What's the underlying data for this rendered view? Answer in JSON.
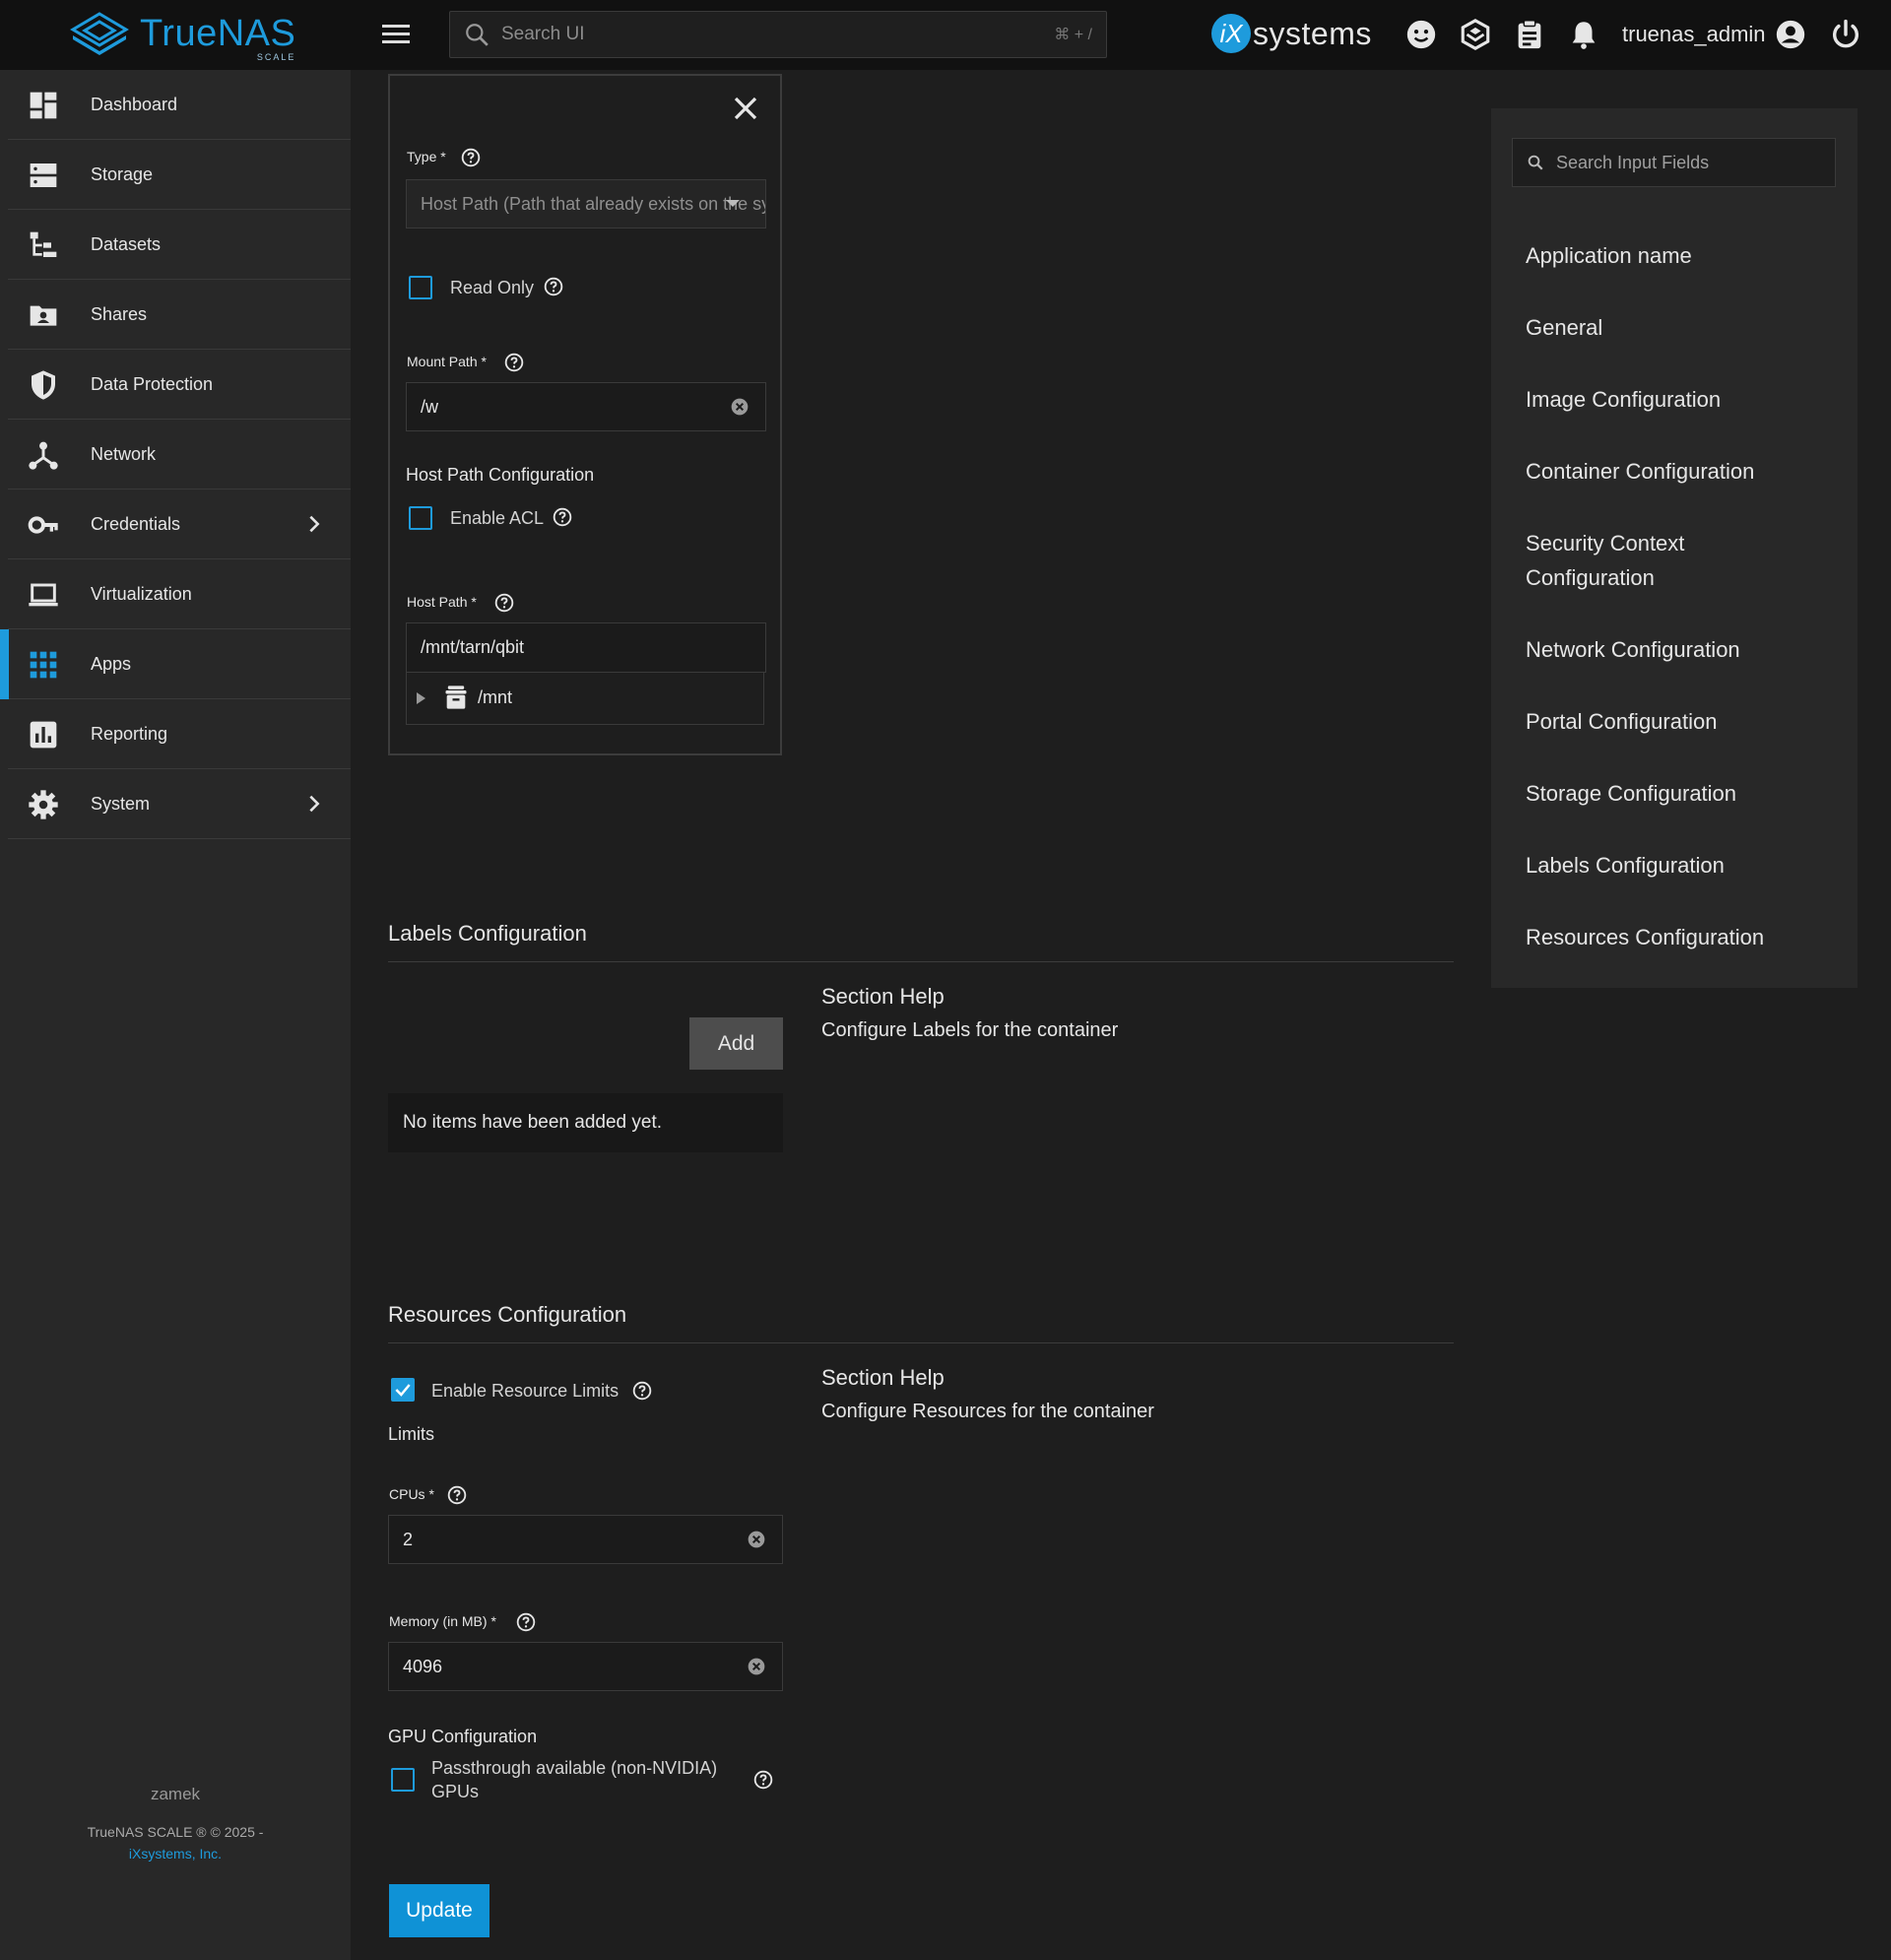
{
  "topbar": {
    "logo_name": "TrueNAS",
    "logo_sub": "SCALE",
    "search_placeholder": "Search UI",
    "search_shortcut": "⌘ + /",
    "vendor_logo_mark": "iX",
    "vendor_logo_text": "systems",
    "username": "truenas_admin",
    "icons": [
      "menu-icon",
      "search-icon",
      "feedback-icon",
      "truecommand-icon",
      "jobs-icon",
      "notifications-icon",
      "account-icon",
      "power-icon"
    ]
  },
  "sidebar": {
    "items": [
      {
        "label": "Dashboard",
        "icon": "dashboard-icon"
      },
      {
        "label": "Storage",
        "icon": "storage-icon"
      },
      {
        "label": "Datasets",
        "icon": "datasets-icon"
      },
      {
        "label": "Shares",
        "icon": "shares-icon"
      },
      {
        "label": "Data Protection",
        "icon": "shield-icon"
      },
      {
        "label": "Network",
        "icon": "network-icon"
      },
      {
        "label": "Credentials",
        "icon": "key-icon",
        "has_submenu": true
      },
      {
        "label": "Virtualization",
        "icon": "laptop-icon"
      },
      {
        "label": "Apps",
        "icon": "apps-icon",
        "active": true
      },
      {
        "label": "Reporting",
        "icon": "reporting-icon"
      },
      {
        "label": "System",
        "icon": "gear-icon",
        "has_submenu": true
      }
    ],
    "hostname": "zamek",
    "copyright": "TrueNAS SCALE ® © 2025 -",
    "company_link": "iXsystems, Inc."
  },
  "storage_panel": {
    "type_label": "Type *",
    "type_value": "Host Path (Path that already exists on the system)",
    "read_only_label": "Read Only",
    "read_only_checked": false,
    "mount_path_label": "Mount Path *",
    "mount_path_value": "/w",
    "host_path_config_heading": "Host Path Configuration",
    "enable_acl_label": "Enable ACL",
    "enable_acl_checked": false,
    "host_path_label": "Host Path *",
    "host_path_value": "/mnt/tarn/qbit",
    "tree_root": "/mnt"
  },
  "labels_section": {
    "title": "Labels Configuration",
    "help_title": "Section Help",
    "help_text": "Configure Labels for the container",
    "add_label": "Add",
    "empty_text": "No items have been added yet."
  },
  "resources_section": {
    "title": "Resources Configuration",
    "help_title": "Section Help",
    "help_text": "Configure Resources for the container",
    "enable_limits_label": "Enable Resource Limits",
    "enable_limits_checked": true,
    "limits_heading": "Limits",
    "cpus_label": "CPUs *",
    "cpus_value": "2",
    "memory_label": "Memory (in MB) *",
    "memory_value": "4096",
    "gpu_heading": "GPU Configuration",
    "gpu_line1": "Passthrough available (non-NVIDIA)",
    "gpu_line2": "GPUs",
    "gpu_checked": false
  },
  "update_label": "Update",
  "right_nav": {
    "search_placeholder": "Search Input Fields",
    "items": [
      "Application name",
      "General",
      "Image Configuration",
      "Container Configuration",
      "Security Context",
      "Configuration",
      "Network Configuration",
      "Portal Configuration",
      "Storage Configuration",
      "Labels Configuration",
      "Resources Configuration"
    ]
  },
  "colors": {
    "accent": "#1e9bdc",
    "background": "#1e1e1e",
    "sidebar": "#282828",
    "topbar": "#111111",
    "update_button": "#0f92d6"
  }
}
